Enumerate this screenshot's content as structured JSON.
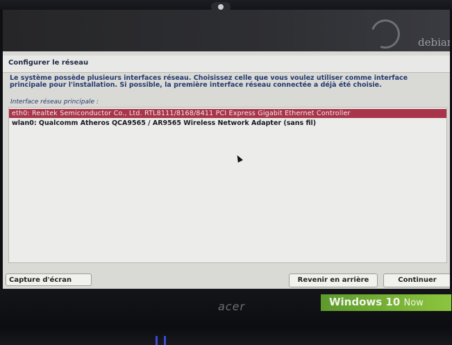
{
  "installer": {
    "brand_logo": "debian",
    "dialog_title": "Configurer le réseau",
    "description": "Le système possède plusieurs interfaces réseau. Choisissez celle que vous voulez utiliser comme interface principale pour l'installation. Si possible, la première interface réseau connectée a déjà été choisie.",
    "list_label": "Interface réseau principale :",
    "interfaces": [
      {
        "label": "eth0: Realtek Semiconductor Co., Ltd. RTL8111/8168/8411 PCI Express Gigabit Ethernet Controller",
        "selected": true
      },
      {
        "label": "wlan0: Qualcomm Atheros QCA9565 / AR9565 Wireless Network Adapter (sans fil)",
        "selected": false
      }
    ],
    "buttons": {
      "screenshot": "Capture d'écran",
      "back": "Revenir en arrière",
      "continue": "Continuer"
    }
  },
  "laptop": {
    "brand": "acer",
    "sticker_windows": "Windows 10",
    "sticker_now": "Now"
  },
  "colors": {
    "selection": "#a8354a",
    "text_blue": "#243a6e",
    "sticker_green": "#8cc53d"
  }
}
